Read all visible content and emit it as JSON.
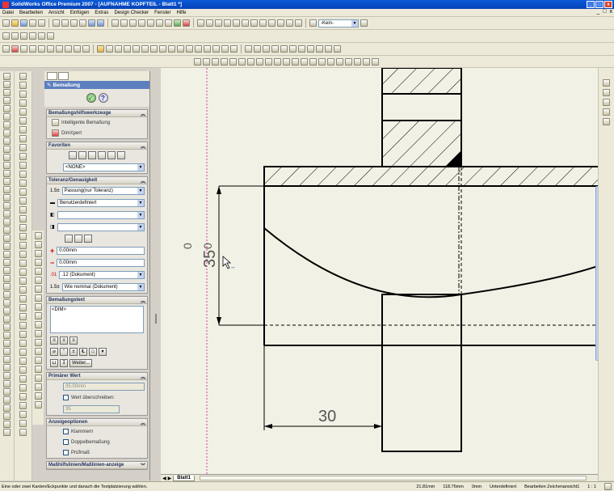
{
  "window": {
    "title": "SolidWorks Office Premium 2007 - [AUFNAHME KOPFTEIL - Blatt1 *]",
    "controls": [
      "_",
      "□",
      "x"
    ]
  },
  "menu": {
    "items": [
      "Datei",
      "Bearbeiten",
      "Ansicht",
      "Einfügen",
      "Extras",
      "Design Checker",
      "Fenster",
      "Hilfe"
    ],
    "doc_controls": [
      "_",
      "□",
      "x"
    ]
  },
  "toolbar": {
    "layer_combo": "-Kein-"
  },
  "property_manager": {
    "title": "Bemaßung",
    "groups": {
      "tools": {
        "title": "Bemaßungshilfswerkzeuge",
        "items": [
          "Intelligente Bemaßung",
          "DimXpert"
        ]
      },
      "favorites": {
        "title": "Favoriten",
        "select": "<NONE>"
      },
      "tolerance": {
        "title": "Toleranz/Genauigkeit",
        "tolerance_type": "Passung(nur Toleranz)",
        "user_defined": "Benutzerdefiniert",
        "fit_hole": "",
        "fit_shaft": "",
        "plus_value": "0.00mm",
        "minus_value": "0.00mm",
        "precision": ".12 (Dokument)",
        "tolerance_precision": "Wie nominal (Dokument)"
      },
      "dimtext": {
        "title": "Bemaßungstext",
        "text": "<DIM>",
        "more_button": "Weiter..."
      },
      "primary": {
        "title": "Primärer Wert",
        "value": "35.00mm",
        "override_label": "Wert überschreiben:",
        "override_value": "35"
      },
      "display": {
        "title": "Anzeigeoptionen",
        "options": [
          "Klammern",
          "Doppelbemaßung",
          "Prüfmaß"
        ]
      },
      "more": {
        "title": "Maßhilfslinien/Maßlinien-anzeige"
      }
    }
  },
  "drawing": {
    "dim_vertical": "35",
    "dim_vertical_tol_plus": "0",
    "dim_vertical_tol_minus": "0",
    "dim_horizontal": "30"
  },
  "sheet_tab": "Blatt1",
  "status": {
    "hint": "Eine oder zwei Kanten/Eckpunkte und danach die Textplatzierung wählen.",
    "x": "21.81mm",
    "y": "118.76mm",
    "z": "0mm",
    "state": "Unterdefiniert",
    "edit": "Bearbeiten Zeichenansicht1",
    "scale": "1 : 1"
  }
}
